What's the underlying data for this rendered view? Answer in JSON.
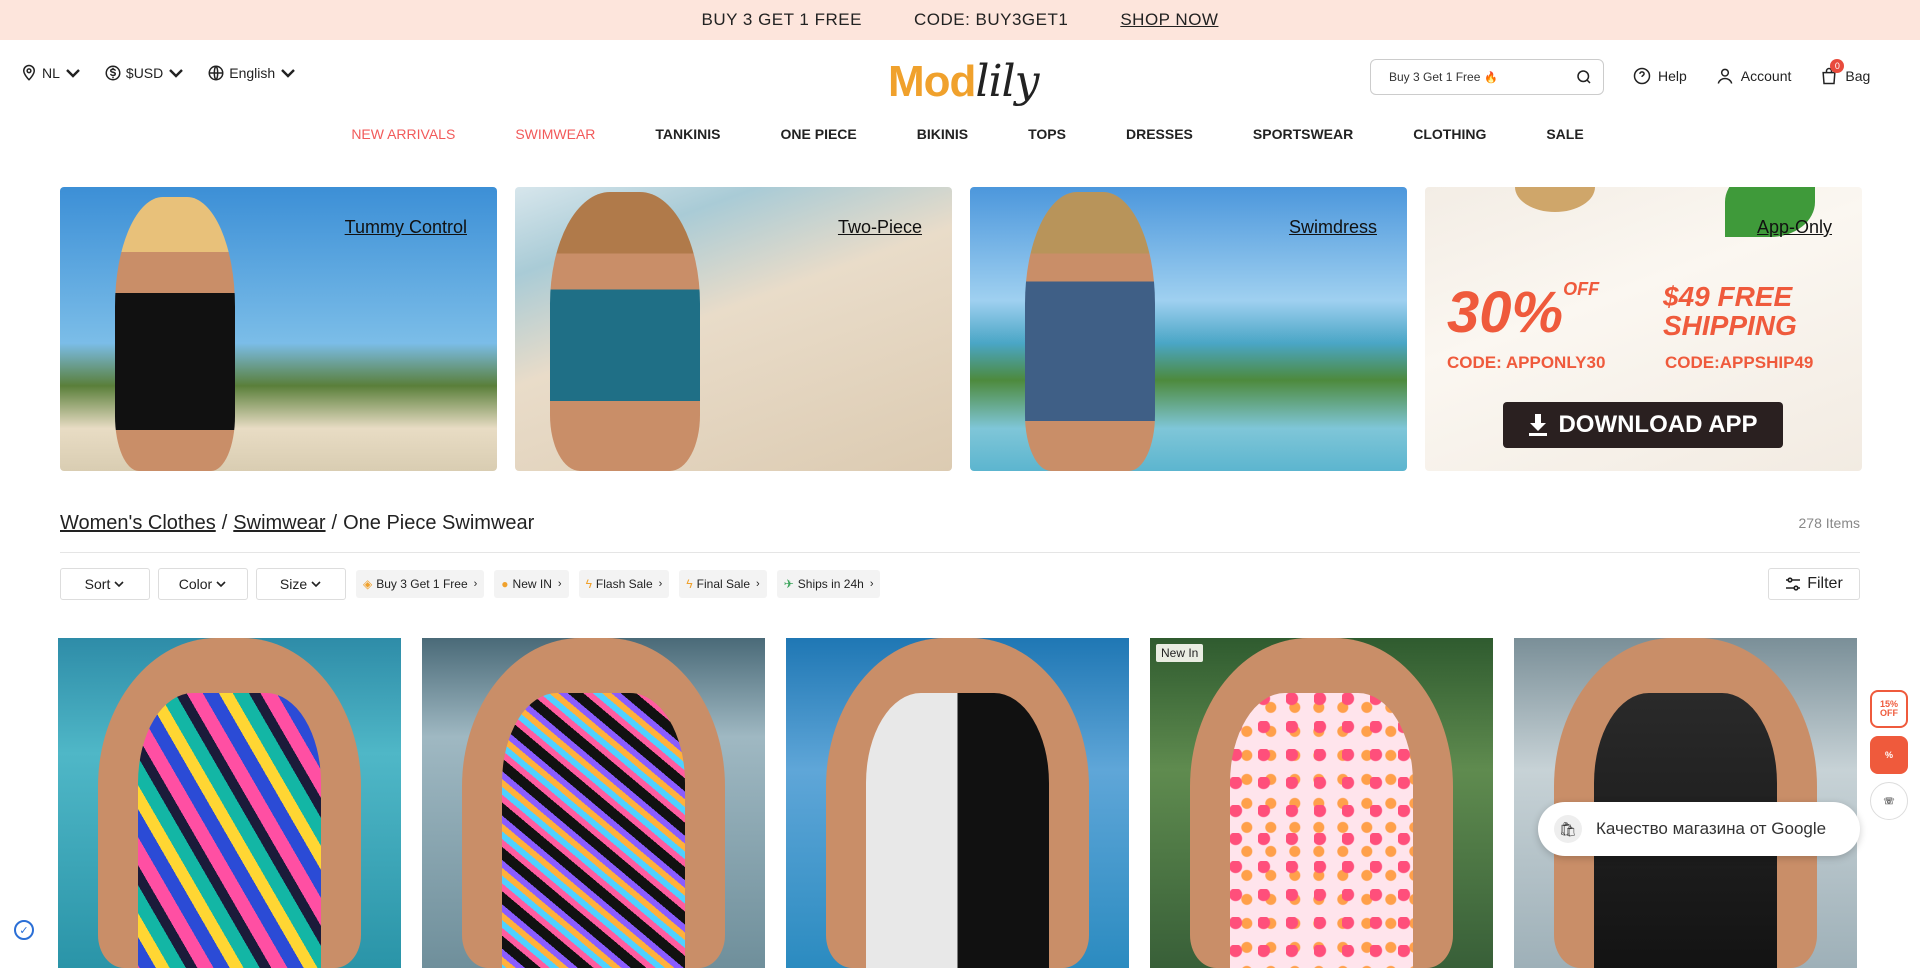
{
  "promo_bar": {
    "offer": "BUY 3 GET 1 FREE",
    "code": "CODE: BUY3GET1",
    "cta": "SHOP NOW"
  },
  "header": {
    "region": "NL",
    "currency": "$USD",
    "language": "English",
    "logo_part1": "Mod",
    "logo_part2": "lily",
    "search_placeholder": "Buy 3 Get 1 Free",
    "search_emoji": "🔥",
    "help": "Help",
    "account": "Account",
    "bag": "Bag",
    "bag_count": "0"
  },
  "nav": {
    "items": [
      {
        "label": "NEW ARRIVALS",
        "hot": true
      },
      {
        "label": "SWIMWEAR",
        "hot": true
      },
      {
        "label": "TANKINIS",
        "hot": false
      },
      {
        "label": "ONE PIECE",
        "hot": false
      },
      {
        "label": "BIKINIS",
        "hot": false
      },
      {
        "label": "TOPS",
        "hot": false
      },
      {
        "label": "DRESSES",
        "hot": false
      },
      {
        "label": "SPORTSWEAR",
        "hot": false
      },
      {
        "label": "CLOTHING",
        "hot": false
      },
      {
        "label": "SALE",
        "hot": false
      }
    ]
  },
  "banners": [
    {
      "label": "Tummy Control"
    },
    {
      "label": "Two-Piece"
    },
    {
      "label": "Swimdress"
    },
    {
      "label": "App-Only"
    }
  ],
  "app_banner": {
    "discount": "30%",
    "off": "OFF",
    "free_shipping": "$49 FREE SHIPPING",
    "code1": "CODE: APPONLY30",
    "code2": "CODE:APPSHIP49",
    "download": "DOWNLOAD APP"
  },
  "breadcrumb": {
    "crumb1": "Women's Clothes",
    "crumb2": "Swimwear",
    "current": "One Piece Swimwear",
    "sep": "/"
  },
  "items_count": "278 Items",
  "filters": {
    "sort": "Sort",
    "color": "Color",
    "size": "Size",
    "filter": "Filter",
    "tags": [
      {
        "icon": "tag-icon",
        "label": "Buy 3 Get 1 Free"
      },
      {
        "icon": "new-icon",
        "label": "New IN"
      },
      {
        "icon": "lightning-icon",
        "label": "Flash Sale"
      },
      {
        "icon": "lightning-icon",
        "label": "Final Sale"
      },
      {
        "icon": "plane-icon",
        "label": "Ships in 24h"
      }
    ]
  },
  "products": [
    {
      "badge": ""
    },
    {
      "badge": ""
    },
    {
      "badge": ""
    },
    {
      "badge": "New In"
    },
    {
      "badge": ""
    }
  ],
  "widgets": {
    "coupon": "15% OFF",
    "google_badge": "Качество магазина от Google"
  },
  "colors": {
    "promo_bg": "#fde5dc",
    "accent": "#ef5a3c",
    "nav_hot": "#f25a5a",
    "logo_orange": "#f0a12c"
  }
}
